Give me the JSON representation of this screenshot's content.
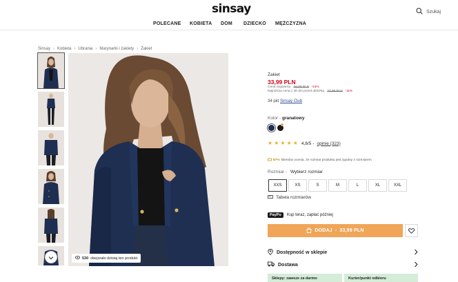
{
  "header": {
    "logo": "sinsay",
    "search_label": "Szukaj",
    "search_icon": "search-icon",
    "nav": [
      "POLECANE",
      "KOBIETA",
      "DOM",
      "DZIECKO",
      "MĘŻCZYZNA"
    ]
  },
  "breadcrumb": [
    "Sinsay",
    "Kobieta",
    "Ubrania",
    "Marynarki i żakiety",
    "Żakiet"
  ],
  "gallery": {
    "thumbnail_count": 6,
    "scroll_icon": "chevron-down-icon",
    "viewers_count": "530",
    "viewers_text": "obejrzało dzisiaj ten produkt",
    "viewers_icon": "eye-icon"
  },
  "product": {
    "name": "Żakiet",
    "price": "33,99 PLN",
    "regular_label": "Cena regularna",
    "regular_price": "49,99 PLN",
    "regular_discount": "-31%",
    "lowest_label": "Najniższa cena z 30 dni przed obniżką",
    "lowest_price": "37,99 PLN",
    "lowest_discount": "-11%",
    "club_points": "34 pkt",
    "club_link": "Sinsay Club",
    "color_label": "Kolor",
    "color_value": "granatowy",
    "swatches": [
      "#1e2f52",
      "#1a1a1a"
    ],
    "rating": "4,8/5",
    "reviews_link": "opinie (323)",
    "fit_pct": "87%",
    "fit_text": "klientów ocenia, że rozmiar produktu jest zgodny z rozmiarem",
    "size_label": "Rozmiar",
    "size_placeholder": "Wybierz rozmiar",
    "sizes": [
      "XXS",
      "XS",
      "S",
      "M",
      "L",
      "XL",
      "XXL"
    ],
    "size_table": "Tabela rozmiarów",
    "paypo_logo": "PayPo",
    "paypo_text": "Kup teraz, zapłać później",
    "add_button": "DODAJ",
    "add_price": "33,99 PLN",
    "store_availability": "Dostępność w sklepie",
    "delivery": "Dostawa",
    "delivery_options": [
      "Sklepy: zawsze za darmo",
      "Kurier/punkt odbioru"
    ]
  },
  "colors": {
    "accent_orange": "#f0a558",
    "price_red": "#d0021b",
    "delivery_green": "#d4ecd8",
    "jacket_navy": "#1e2f52"
  }
}
